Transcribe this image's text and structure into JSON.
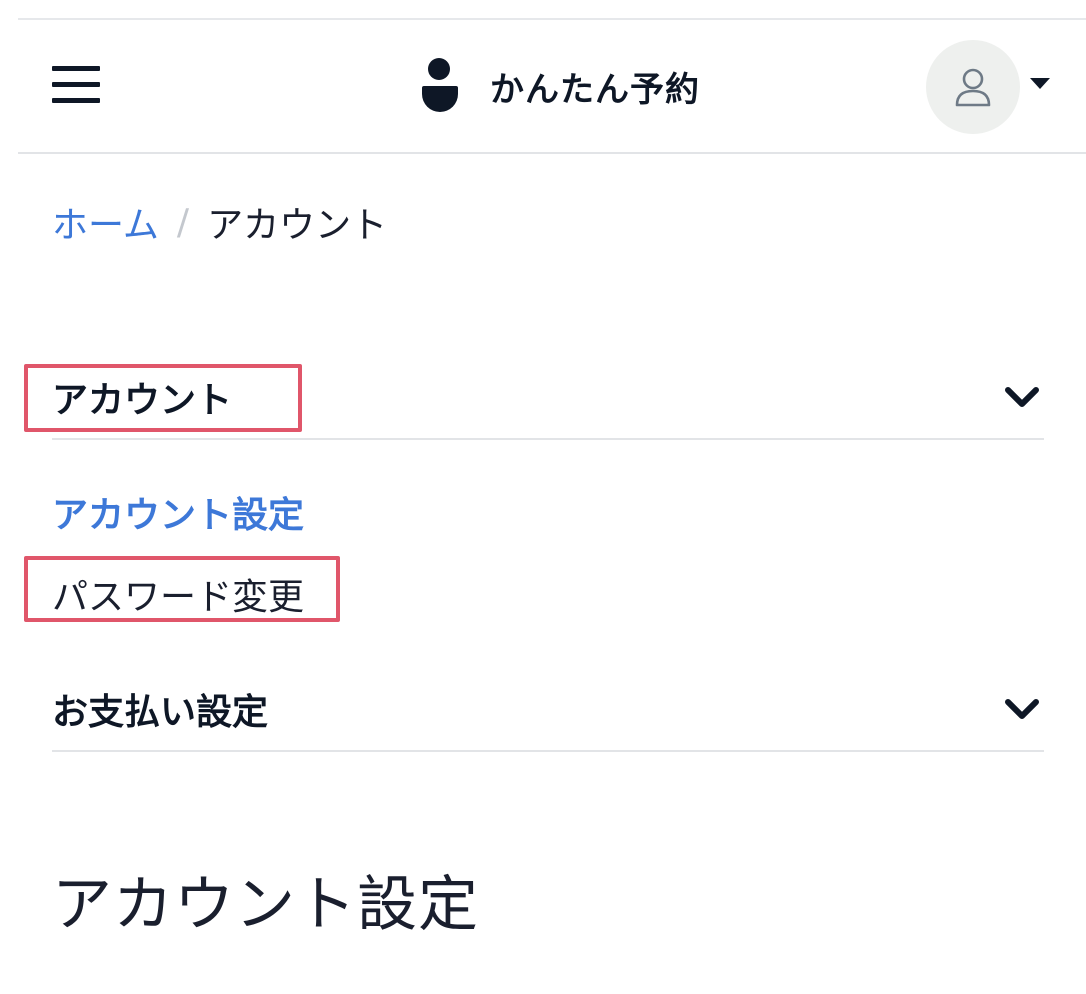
{
  "header": {
    "brand_name": "かんたん予約",
    "menu_icon": "hamburger-menu-icon",
    "brand_icon": "person-logo-icon",
    "account_icon": "user-icon",
    "account_caret_icon": "caret-down-icon"
  },
  "breadcrumb": {
    "home": "ホーム",
    "separator": "/",
    "current": "アカウント"
  },
  "menu": {
    "sections": [
      {
        "title": "アカウント",
        "expanded": true,
        "items": [
          {
            "label": "アカウント設定",
            "active": true
          },
          {
            "label": "パスワード変更",
            "active": false
          }
        ]
      },
      {
        "title": "お支払い設定",
        "expanded": false
      }
    ]
  },
  "main": {
    "page_title": "アカウント設定"
  },
  "colors": {
    "link": "#3d78d8",
    "text": "#1a1f2e",
    "highlight": "#e0566a",
    "avatar_bg": "#eef0ee"
  }
}
